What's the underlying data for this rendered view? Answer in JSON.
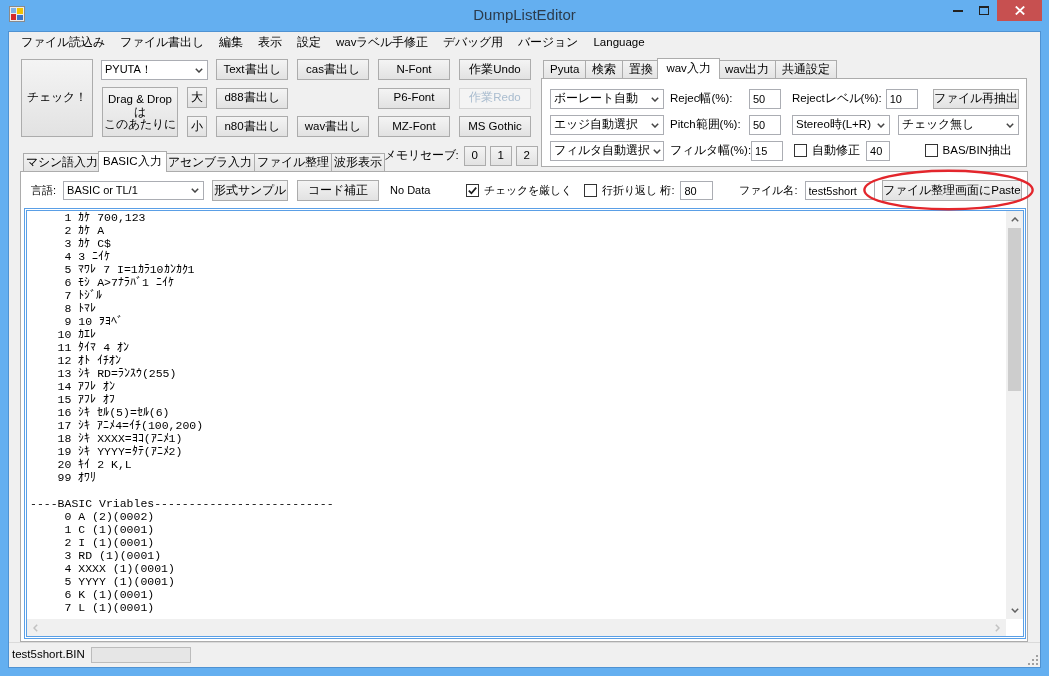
{
  "window": {
    "title": "DumpListEditor"
  },
  "menu": [
    "ファイル読込み",
    "ファイル書出し",
    "編集",
    "表示",
    "設定",
    "wavラベル手修正",
    "デバッグ用",
    "バージョン",
    "Language"
  ],
  "toolbar": {
    "check_button": "チェック！",
    "machine_select": "PYUTA！",
    "drop_zone": [
      "Drag & Drop",
      "は",
      "このあたりに"
    ],
    "size_buttons": [
      "大",
      "小"
    ],
    "button_columns": [
      [
        {
          "label": "Text書出し",
          "disabled": false
        },
        {
          "label": "d88書出し",
          "disabled": false
        },
        {
          "label": "n80書出し",
          "disabled": false
        }
      ],
      [
        {
          "label": "cas書出し",
          "disabled": false
        },
        {
          "label": "wav書出し",
          "disabled": false
        }
      ],
      [
        {
          "label": "N-Font",
          "disabled": false
        },
        {
          "label": "P6-Font",
          "disabled": false
        },
        {
          "label": "MZ-Font",
          "disabled": false
        }
      ],
      [
        {
          "label": "作業Undo",
          "disabled": false
        },
        {
          "label": "作業Redo",
          "disabled": true
        },
        {
          "label": "MS Gothic",
          "disabled": false
        }
      ]
    ],
    "memory_save": {
      "label": "メモリセーブ:",
      "buttons": [
        "0",
        "1",
        "2"
      ]
    }
  },
  "wav_panel": {
    "tabs": [
      {
        "label": "Pyuta",
        "selected": false
      },
      {
        "label": "検索",
        "selected": false
      },
      {
        "label": "置換",
        "selected": false
      },
      {
        "label": "wav入力",
        "selected": true
      },
      {
        "label": "wav出力",
        "selected": false
      },
      {
        "label": "共通設定",
        "selected": false
      }
    ],
    "rows": [
      [
        {
          "kind": "select",
          "value": "ボーレート自動"
        },
        {
          "kind": "label",
          "text": "Rejec幅(%):"
        },
        {
          "kind": "input",
          "value": "50"
        },
        {
          "kind": "label",
          "text": "Rejectレベル(%):"
        },
        {
          "kind": "input",
          "value": "10"
        },
        {
          "kind": "button",
          "label": "ファイル再抽出"
        }
      ],
      [
        {
          "kind": "select",
          "value": "エッジ自動選択"
        },
        {
          "kind": "label",
          "text": "Pitch範囲(%):"
        },
        {
          "kind": "input",
          "value": "50"
        },
        {
          "kind": "select",
          "value": "Stereo時(L+R)"
        },
        {
          "kind": "select",
          "value": "チェック無し"
        }
      ],
      [
        {
          "kind": "select",
          "value": "フィルタ自動選択"
        },
        {
          "kind": "label",
          "text": "フィルタ幅(%):"
        },
        {
          "kind": "input",
          "value": "15"
        },
        {
          "kind": "checkbox",
          "label": "自動修正",
          "checked": false
        },
        {
          "kind": "input",
          "value": "40"
        },
        {
          "kind": "checkbox",
          "label": "BAS/BIN抽出",
          "checked": false
        }
      ]
    ]
  },
  "main_tabs": [
    {
      "label": "マシン語入力",
      "selected": false
    },
    {
      "label": "BASIC入力",
      "selected": true
    },
    {
      "label": "アセンブラ入力",
      "selected": false
    },
    {
      "label": "ファイル整理",
      "selected": false
    },
    {
      "label": "波形表示",
      "selected": false
    }
  ],
  "basic_tab": {
    "options": [
      {
        "kind": "label",
        "text": "言語:"
      },
      {
        "kind": "select",
        "value": "BASIC or TL/1"
      },
      {
        "kind": "button",
        "label": "形式サンプル",
        "highlighted": false
      },
      {
        "kind": "button",
        "label": "コード補正",
        "highlighted": false
      },
      {
        "kind": "status",
        "text": "No Data"
      },
      {
        "kind": "checkbox",
        "label": "チェックを厳しく",
        "checked": true
      },
      {
        "kind": "checkbox",
        "label": "行折り返し",
        "checked": false
      },
      {
        "kind": "label",
        "text": "桁:"
      },
      {
        "kind": "input",
        "value": "80"
      },
      {
        "kind": "label",
        "text": "ファイル名:"
      },
      {
        "kind": "input",
        "value": "test5short"
      },
      {
        "kind": "button",
        "label": "ファイル整理画面にPaste",
        "highlighted": true
      }
    ],
    "editor": {
      "program": [
        {
          "line_no": "1",
          "code": "ｶｹ 700,123"
        },
        {
          "line_no": "2",
          "code": "ｶｹ A"
        },
        {
          "line_no": "3",
          "code": "ｶｹ C$"
        },
        {
          "line_no": "4",
          "code": "3 ﾆｲｹ"
        },
        {
          "line_no": "5",
          "code": "ﾏﾜﾚ 7 I=1ｶﾗ10ｶﾝｶｸ1"
        },
        {
          "line_no": "6",
          "code": "ﾓｼ A>7ﾅﾗﾊﾞ1 ﾆｲｹ"
        },
        {
          "line_no": "7",
          "code": "ﾄｼﾞﾙ"
        },
        {
          "line_no": "8",
          "code": "ﾄﾏﾚ"
        },
        {
          "line_no": "9",
          "code": "10 ｦﾖﾍﾞ"
        },
        {
          "line_no": "10",
          "code": "ｶｴﾚ"
        },
        {
          "line_no": "11",
          "code": "ﾀｲﾏ 4 ｵﾝ"
        },
        {
          "line_no": "12",
          "code": "ｵﾄ ｲﾁｵﾝ"
        },
        {
          "line_no": "13",
          "code": "ｼｷ RD=ﾗﾝｽｳ(255)"
        },
        {
          "line_no": "14",
          "code": "ｱﾌﾚ ｵﾝ"
        },
        {
          "line_no": "15",
          "code": "ｱﾌﾚ ｵﾌ"
        },
        {
          "line_no": "16",
          "code": "ｼｷ ｾﾙ(5)=ｾﾙ(6)"
        },
        {
          "line_no": "17",
          "code": "ｼｷ ｱﾆﾒ4=ｲﾁ(100,200)"
        },
        {
          "line_no": "18",
          "code": "ｼｷ XXXX=ﾖｺ(ｱﾆﾒ1)"
        },
        {
          "line_no": "19",
          "code": "ｼｷ YYYY=ﾀﾃ(ｱﾆﾒ2)"
        },
        {
          "line_no": "20",
          "code": "ｷｲ 2 K,L"
        },
        {
          "line_no": "99",
          "code": "ｵﾜﾘ"
        }
      ],
      "variables_heading": "----BASIC Vriables--------------------------",
      "variables": [
        {
          "index": "0",
          "entry": "A (2)(0002)"
        },
        {
          "index": "1",
          "entry": "C (1)(0001)"
        },
        {
          "index": "2",
          "entry": "I (1)(0001)"
        },
        {
          "index": "3",
          "entry": "RD (1)(0001)"
        },
        {
          "index": "4",
          "entry": "XXXX (1)(0001)"
        },
        {
          "index": "5",
          "entry": "YYYY (1)(0001)"
        },
        {
          "index": "6",
          "entry": "K (1)(0001)"
        },
        {
          "index": "7",
          "entry": "L (1)(0001)"
        }
      ]
    }
  },
  "status_bar": {
    "file_name": "test5short.BIN",
    "progress": {
      "level": 0
    }
  }
}
